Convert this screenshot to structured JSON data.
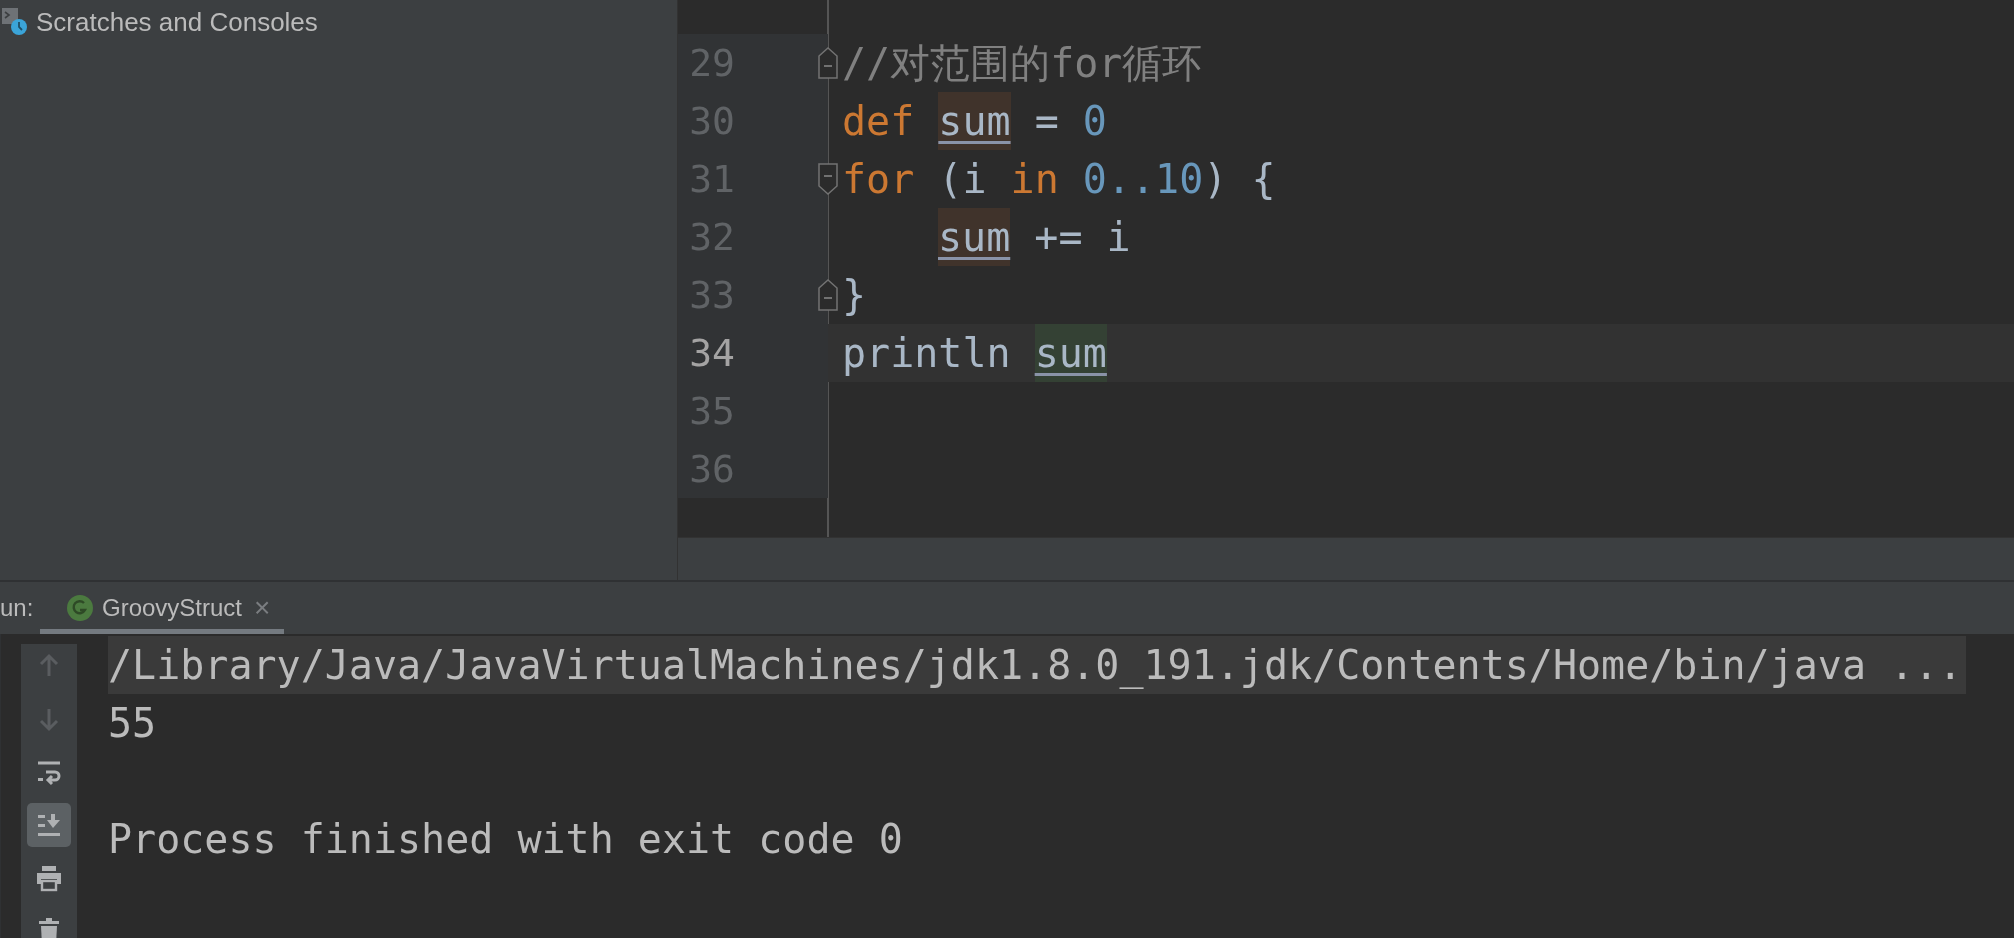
{
  "project_panel": {
    "items": [
      {
        "label": "Scratches and Consoles"
      }
    ]
  },
  "editor": {
    "lines": [
      {
        "number": "29",
        "current": false,
        "fold_open": false,
        "fold_close": true,
        "indented": false,
        "tokens": [
          {
            "text": "//对范围的for循环",
            "kind": "comment"
          }
        ]
      },
      {
        "number": "30",
        "current": false,
        "fold_open": false,
        "fold_close": false,
        "indented": false,
        "tokens": [
          {
            "text": "def ",
            "kind": "keyword"
          },
          {
            "text": "sum",
            "kind": "var-write"
          },
          {
            "text": " = ",
            "kind": "plain"
          },
          {
            "text": "0",
            "kind": "number"
          }
        ]
      },
      {
        "number": "31",
        "current": false,
        "fold_open": true,
        "fold_close": false,
        "indented": false,
        "tokens": [
          {
            "text": "for ",
            "kind": "keyword"
          },
          {
            "text": "(i ",
            "kind": "plain"
          },
          {
            "text": "in ",
            "kind": "keyword"
          },
          {
            "text": "0..10",
            "kind": "number"
          },
          {
            "text": ") {",
            "kind": "plain"
          }
        ]
      },
      {
        "number": "32",
        "current": false,
        "fold_open": false,
        "fold_close": false,
        "indented": true,
        "tokens": [
          {
            "text": "sum",
            "kind": "var-write"
          },
          {
            "text": " += i",
            "kind": "plain"
          }
        ]
      },
      {
        "number": "33",
        "current": false,
        "fold_open": false,
        "fold_close": true,
        "indented": false,
        "tokens": [
          {
            "text": "}",
            "kind": "plain"
          }
        ]
      },
      {
        "number": "34",
        "current": true,
        "fold_open": false,
        "fold_close": false,
        "indented": false,
        "tokens": [
          {
            "text": "println ",
            "kind": "plain"
          },
          {
            "text": "sum",
            "kind": "var-read"
          }
        ]
      },
      {
        "number": "35",
        "current": false,
        "fold_open": false,
        "fold_close": false
      },
      {
        "number": "36",
        "current": false,
        "fold_open": false,
        "fold_close": false
      }
    ]
  },
  "run_panel": {
    "label": "un:",
    "tabs": [
      {
        "label": "GroovyStruct",
        "selected": true,
        "close": "×"
      }
    ],
    "toolbar": [
      {
        "kind": "up",
        "disabled": true,
        "selected": false
      },
      {
        "kind": "down",
        "disabled": true,
        "selected": false
      },
      {
        "kind": "wrap",
        "disabled": false,
        "selected": false
      },
      {
        "kind": "scroll-end",
        "disabled": false,
        "selected": true
      },
      {
        "kind": "print",
        "disabled": false,
        "selected": false
      },
      {
        "kind": "trash",
        "disabled": false,
        "selected": false
      }
    ],
    "console": [
      {
        "text": "/Library/Java/JavaVirtualMachines/jdk1.8.0_191.jdk/Contents/Home/bin/java ...",
        "kind": "command"
      },
      {
        "text": "55",
        "kind": "output"
      },
      {
        "text": "Process finished with exit code 0",
        "kind": "system"
      }
    ]
  }
}
